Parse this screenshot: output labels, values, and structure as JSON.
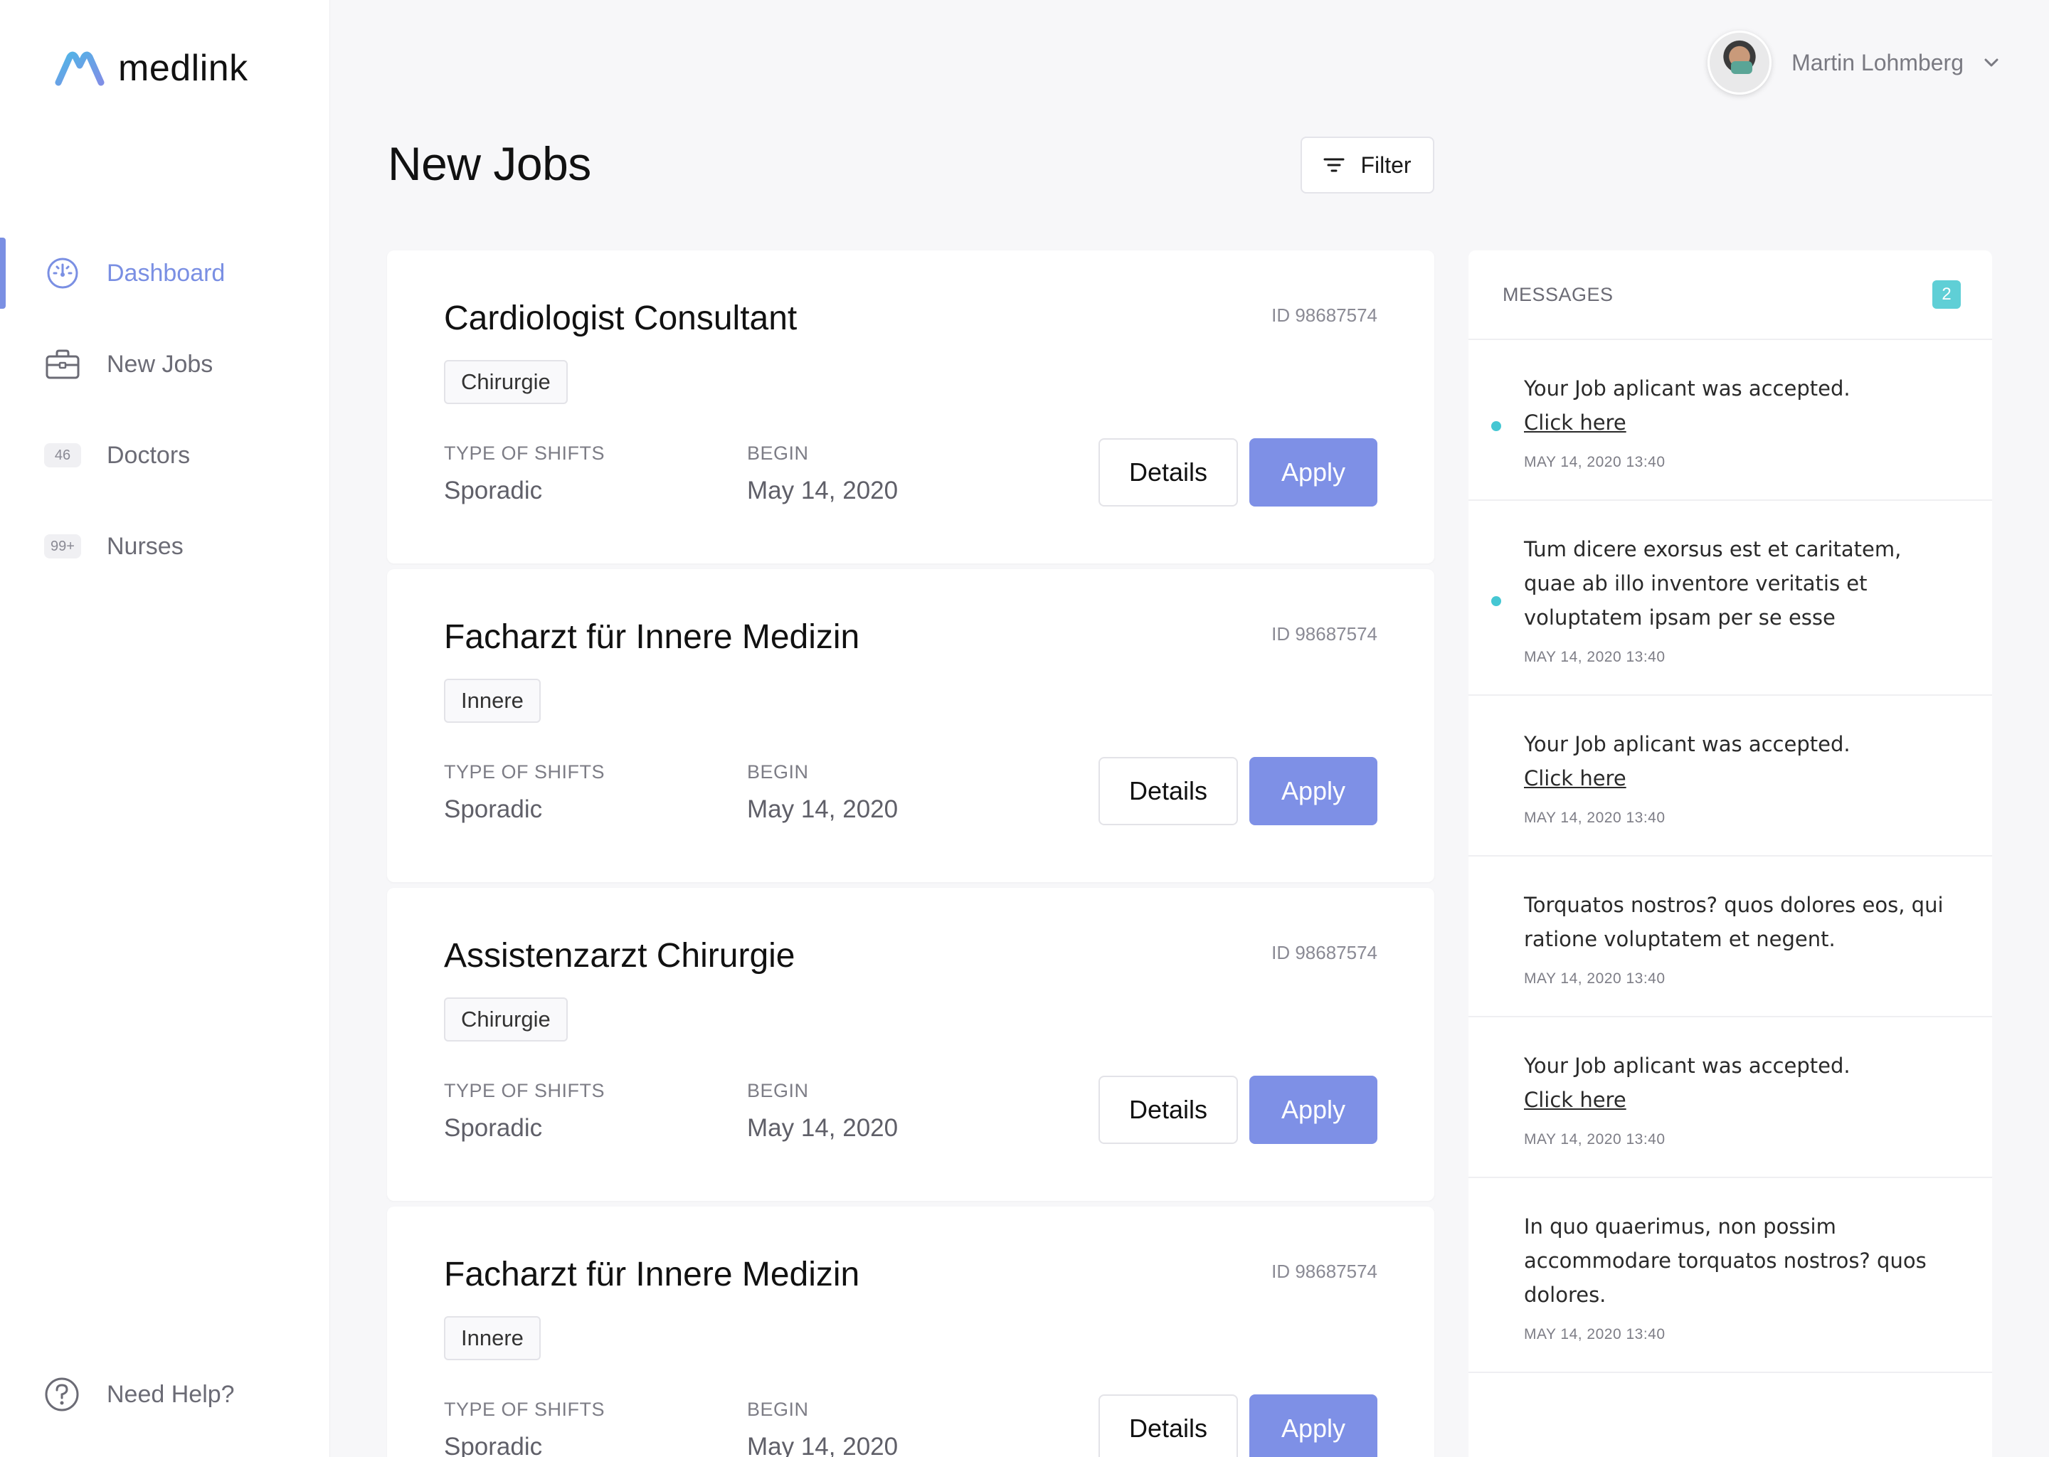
{
  "brand": {
    "name": "medlink"
  },
  "sidebar": {
    "items": [
      {
        "label": "Dashboard",
        "icon": "gauge-icon",
        "active": true
      },
      {
        "label": "New Jobs",
        "icon": "briefcase-icon"
      },
      {
        "label": "Doctors",
        "badge": "46"
      },
      {
        "label": "Nurses",
        "badge": "99+"
      }
    ],
    "help": {
      "label": "Need Help?",
      "icon": "help-circle-icon"
    }
  },
  "header": {
    "user_name": "Martin Lohmberg"
  },
  "main": {
    "title": "New Jobs",
    "filter_label": "Filter",
    "field_labels": {
      "shifts": "TYPE OF SHIFTS",
      "begin": "BEGIN"
    },
    "button_labels": {
      "details": "Details",
      "apply": "Apply"
    },
    "jobs": [
      {
        "title": "Cardiologist Consultant",
        "id": "ID 98687574",
        "tag": "Chirurgie",
        "shift": "Sporadic",
        "begin": "May 14, 2020"
      },
      {
        "title": "Facharzt für Innere Medizin",
        "id": "ID 98687574",
        "tag": "Innere",
        "shift": "Sporadic",
        "begin": "May 14, 2020"
      },
      {
        "title": "Assistenzarzt Chirurgie",
        "id": "ID 98687574",
        "tag": "Chirurgie",
        "shift": "Sporadic",
        "begin": "May 14, 2020"
      },
      {
        "title": "Facharzt für Innere Medizin",
        "id": "ID 98687574",
        "tag": "Innere",
        "shift": "Sporadic",
        "begin": "May 14, 2020"
      }
    ]
  },
  "messages": {
    "title": "MESSAGES",
    "count": "2",
    "items": [
      {
        "text": "Your Job aplicant was accepted.",
        "link": "Click here",
        "time": "MAY 14, 2020  13:40",
        "unread": true
      },
      {
        "text": "Tum dicere exorsus est et caritatem, quae ab illo inventore veritatis et voluptatem ipsam per se esse",
        "time": "MAY 14, 2020  13:40",
        "unread": true
      },
      {
        "text": "Your Job aplicant was accepted.",
        "link": "Click here",
        "time": "MAY 14, 2020  13:40"
      },
      {
        "text": "Torquatos nostros? quos dolores eos, qui ratione voluptatem et negent.",
        "time": "MAY 14, 2020  13:40"
      },
      {
        "text": "Your Job aplicant was accepted.",
        "link": "Click here",
        "time": "MAY 14, 2020  13:40"
      },
      {
        "text": "In quo quaerimus, non possim accommodare torquatos nostros? quos dolores.",
        "time": "MAY 14, 2020  13:40"
      }
    ]
  },
  "colors": {
    "accent": "#7e90e6",
    "nav_active": "#7a8fe3",
    "badge_teal": "#5fcfd6",
    "unread_dot": "#45c7d3"
  }
}
